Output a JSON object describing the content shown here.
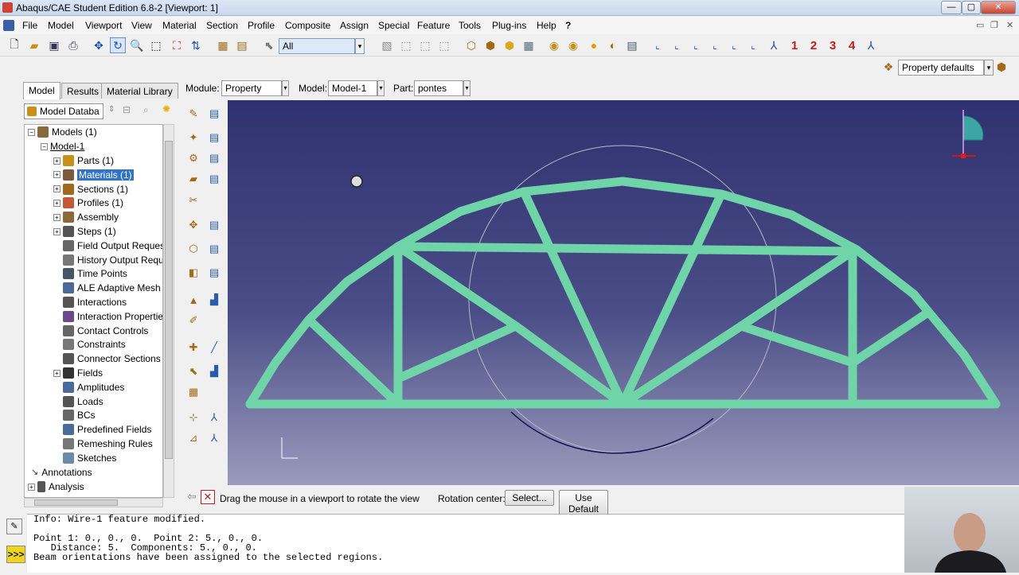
{
  "window": {
    "title": "Abaqus/CAE Student Edition 6.8-2 [Viewport: 1]"
  },
  "menu": [
    "File",
    "Model",
    "Viewport",
    "View",
    "Material",
    "Section",
    "Profile",
    "Composite",
    "Assign",
    "Special",
    "Feature",
    "Tools",
    "Plug-ins",
    "Help",
    "?"
  ],
  "toolbar": {
    "selection_filter": "All",
    "view_numbers": [
      "1",
      "2",
      "3",
      "4"
    ],
    "property_defaults": "Property defaults"
  },
  "context": {
    "module_label": "Module:",
    "module_value": "Property",
    "model_label": "Model:",
    "model_value": "Model-1",
    "part_label": "Part:",
    "part_value": "pontes"
  },
  "tabs": [
    "Model",
    "Results",
    "Material Library"
  ],
  "model_db": "Model Databa",
  "tree": {
    "root": "Models (1)",
    "model": "Model-1",
    "items": [
      "Parts (1)",
      "Materials (1)",
      "Sections (1)",
      "Profiles (1)",
      "Assembly",
      "Steps (1)",
      "Field Output Requests",
      "History Output Reque",
      "Time Points",
      "ALE Adaptive Mesh C",
      "Interactions",
      "Interaction Properties",
      "Contact Controls",
      "Constraints",
      "Connector Sections",
      "Fields",
      "Amplitudes",
      "Loads",
      "BCs",
      "Predefined Fields",
      "Remeshing Rules",
      "Sketches"
    ],
    "annotations": "Annotations",
    "analysis": "Analysis",
    "selected": "Materials (1)"
  },
  "prompt": {
    "text": "Drag the mouse in a viewport to rotate the view",
    "rotation_label": "Rotation center:",
    "select_btn": "Select...",
    "default_btn": "Use Default"
  },
  "messages": [
    "Info: Wire-1 feature modified.",
    "",
    "Point 1: 0., 0., 0.  Point 2: 5., 0., 0.",
    "   Distance: 5.  Components: 5., 0., 0.",
    "Beam orientations have been assigned to the selected regions."
  ],
  "colors": {
    "truss": "#6fd4a8",
    "viewport_top": "#2f3270",
    "viewport_bottom": "#9a9bbd",
    "selected": "#3173c6"
  }
}
